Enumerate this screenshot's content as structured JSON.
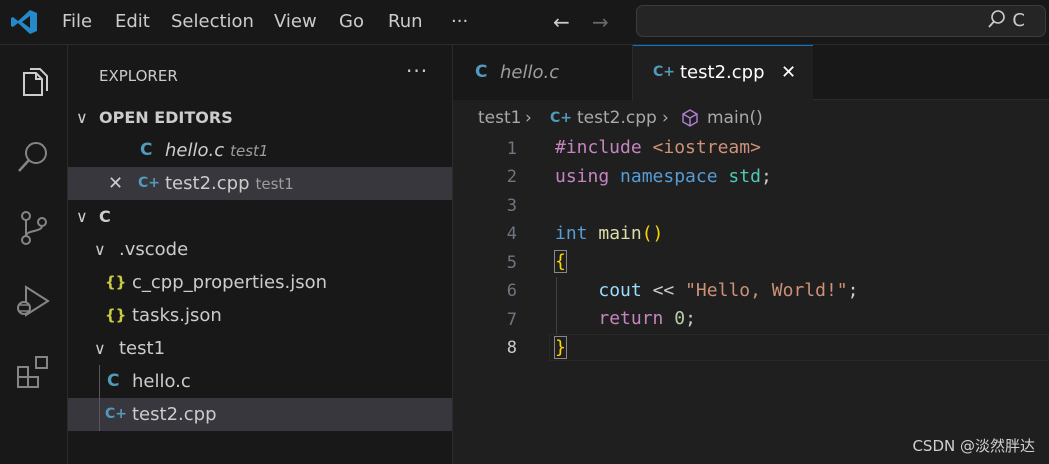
{
  "menu": {
    "items": [
      "File",
      "Edit",
      "Selection",
      "View",
      "Go",
      "Run"
    ],
    "more": "···"
  },
  "command_center": {
    "text": "C"
  },
  "explorer": {
    "title": "EXPLORER",
    "more": "···",
    "open_editors": {
      "label": "OPEN EDITORS",
      "items": [
        {
          "name": "hello.c",
          "folder": "test1",
          "icon": "C"
        },
        {
          "name": "test2.cpp",
          "folder": "test1",
          "icon": "C+"
        }
      ]
    },
    "folder": {
      "label": "C",
      "items": [
        {
          "name": ".vscode"
        },
        {
          "name": "c_cpp_properties.json",
          "icon": "{}"
        },
        {
          "name": "tasks.json",
          "icon": "{}"
        },
        {
          "name": "test1"
        },
        {
          "name": "hello.c",
          "icon": "C"
        },
        {
          "name": "test2.cpp",
          "icon": "C+"
        }
      ]
    }
  },
  "tabs": [
    {
      "label": "hello.c",
      "icon": "C"
    },
    {
      "label": "test2.cpp",
      "icon": "C+",
      "close": "✕"
    }
  ],
  "breadcrumb": {
    "folder": "test1",
    "file": "test2.cpp",
    "symbol": "main()"
  },
  "editor": {
    "line_numbers": [
      "1",
      "2",
      "3",
      "4",
      "5",
      "6",
      "7",
      "8"
    ],
    "code": {
      "l1_kw": "#include",
      "l1_hdr": "<iostream>",
      "l2_kw1": "using",
      "l2_kw2": "namespace",
      "l2_ns": "std",
      "l2_semi": ";",
      "l4_type": "int",
      "l4_fn": "main",
      "l4_parens": "()",
      "l5": "{",
      "l6_var": "cout",
      "l6_op": "<<",
      "l6_str": "\"Hello, World!\"",
      "l6_semi": ";",
      "l7_kw": "return",
      "l7_num": "0",
      "l7_semi": ";",
      "l8": "}"
    },
    "current_line": "8"
  },
  "watermark": "CSDN @淡然胖达",
  "colors": {
    "accent": "#0078d4",
    "c_icon": "#519aba",
    "json_icon": "#cbcb41"
  }
}
